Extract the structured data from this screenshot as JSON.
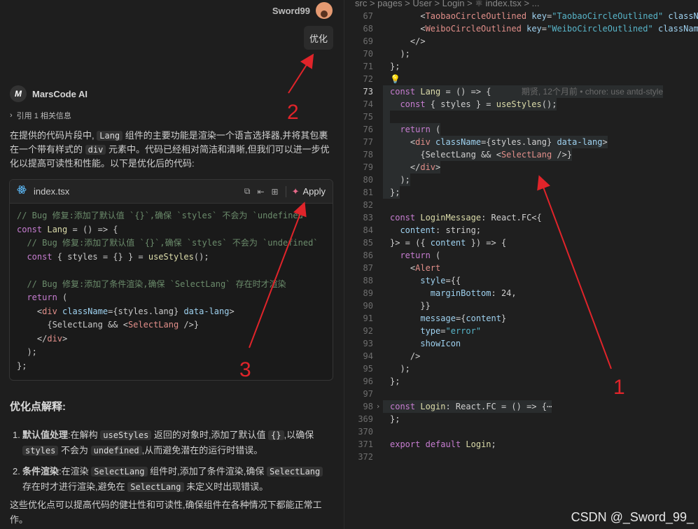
{
  "user": {
    "name": "Sword99",
    "message": "优化"
  },
  "ai": {
    "name": "MarsCode AI",
    "logo": "M",
    "ref": "引用 1 相关信息"
  },
  "intro": {
    "p1": "在提供的代码片段中,",
    "c1": "Lang",
    "p2": "组件的主要功能是渲染一个语言选择器,并将其包裹在一个带有样式的",
    "c2": "div",
    "p3": "元素中。代码已经相对简洁和清晰,但我们可以进一步优化以提高可读性和性能。以下是优化后的代码:"
  },
  "codeblock": {
    "file": "index.tsx",
    "apply": "Apply",
    "lines": [
      "// Bug 修复:添加了默认值 `{}`,确保 `styles` 不会为 `undefined`",
      "const Lang = () => {",
      "  // Bug 修复:添加了默认值 `{}`,确保 `styles` 不会为 `undefined`",
      "  const { styles = {} } = useStyles();",
      "",
      "  // Bug 修复:添加了条件渲染,确保 `SelectLang` 存在时才渲染",
      "  return (",
      "    <div className={styles.lang} data-lang>",
      "      {SelectLang && <SelectLang />}",
      "    </div>",
      "  );",
      "};"
    ]
  },
  "explain": {
    "title": "优化点解释:",
    "items": [
      {
        "num": "1.",
        "bold": "默认值处理",
        "t1": ":在解构",
        "c1": "useStyles",
        "t2": "返回的对象时,添加了默认值",
        "c2": "{}",
        "t3": ",以确保",
        "c3": "styles",
        "t4": "不会为",
        "c4": "undefined",
        "t5": ",从而避免潜在的运行时错误。"
      },
      {
        "num": "2.",
        "bold": "条件渲染",
        "t1": ":在渲染",
        "c1": "SelectLang",
        "t2": "组件时,添加了条件渲染,确保",
        "c2": "SelectLang",
        "t3": "存在时才进行渲染,避免在",
        "c3": "SelectLang",
        "t4": "未定义时出现错误。"
      }
    ],
    "footer": "这些优化点可以提高代码的健壮性和可读性,确保组件在各种情况下都能正常工作。"
  },
  "editor": {
    "breadcrumb": "src > pages > User > Login > ⚛ index.tsx > ...",
    "blame": "期贤, 12个月前 • chore: use antd-style",
    "lines": [
      {
        "n": "67",
        "t": "      <TaobaoCircleOutlined key=\"TaobaoCircleOutlined\" className"
      },
      {
        "n": "68",
        "t": "      <WeiboCircleOutlined key=\"WeiboCircleOutlined\" className"
      },
      {
        "n": "69",
        "t": "    </>"
      },
      {
        "n": "70",
        "t": "  );"
      },
      {
        "n": "71",
        "t": "};"
      },
      {
        "n": "72",
        "t": "💡"
      },
      {
        "n": "73",
        "t": "const Lang = () => {"
      },
      {
        "n": "74",
        "t": "  const { styles } = useStyles();"
      },
      {
        "n": "75",
        "t": ""
      },
      {
        "n": "76",
        "t": "  return ("
      },
      {
        "n": "77",
        "t": "    <div className={styles.lang} data-lang>"
      },
      {
        "n": "78",
        "t": "      {SelectLang && <SelectLang />}"
      },
      {
        "n": "79",
        "t": "    </div>"
      },
      {
        "n": "80",
        "t": "  );"
      },
      {
        "n": "81",
        "t": "};"
      },
      {
        "n": "82",
        "t": ""
      },
      {
        "n": "83",
        "t": "const LoginMessage: React.FC<{"
      },
      {
        "n": "84",
        "t": "  content: string;"
      },
      {
        "n": "85",
        "t": "}> = ({ content }) => {"
      },
      {
        "n": "86",
        "t": "  return ("
      },
      {
        "n": "87",
        "t": "    <Alert"
      },
      {
        "n": "88",
        "t": "      style={{"
      },
      {
        "n": "89",
        "t": "        marginBottom: 24,"
      },
      {
        "n": "90",
        "t": "      }}"
      },
      {
        "n": "91",
        "t": "      message={content}"
      },
      {
        "n": "92",
        "t": "      type=\"error\""
      },
      {
        "n": "93",
        "t": "      showIcon"
      },
      {
        "n": "94",
        "t": "    />"
      },
      {
        "n": "95",
        "t": "  );"
      },
      {
        "n": "96",
        "t": "};"
      },
      {
        "n": "97",
        "t": ""
      },
      {
        "n": "98",
        "t": "const Login: React.FC = () => {⋯"
      },
      {
        "n": "369",
        "t": "};"
      },
      {
        "n": "370",
        "t": ""
      },
      {
        "n": "371",
        "t": "export default Login;"
      },
      {
        "n": "372",
        "t": ""
      }
    ]
  },
  "annotations": {
    "a1": "1",
    "a2": "2",
    "a3": "3",
    "color": "#e0242a"
  },
  "watermark": "CSDN @_Sword_99_"
}
